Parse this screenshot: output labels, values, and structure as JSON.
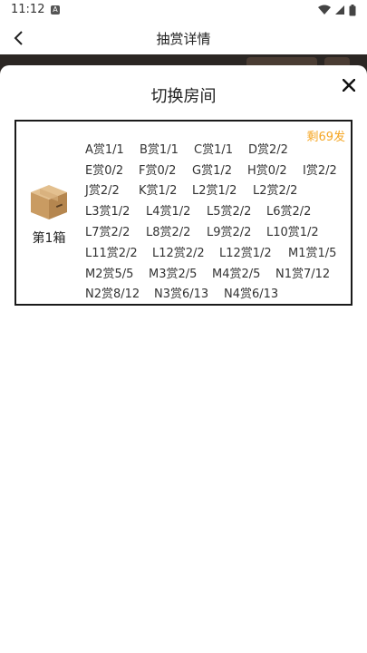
{
  "status": {
    "time": "11:12",
    "notif_letter": "A"
  },
  "nav": {
    "title": "抽赏详情"
  },
  "sheet": {
    "title": "切换房间"
  },
  "room": {
    "label": "第1箱",
    "remaining": "剩69发",
    "rows": [
      [
        "A赏1/1",
        "B赏1/1",
        "C赏1/1",
        "D赏2/2"
      ],
      [
        "E赏0/2",
        "F赏0/2",
        "G赏1/2",
        "H赏0/2",
        "I赏2/2"
      ],
      [
        "J赏2/2",
        "K赏1/2",
        "L2赏1/2",
        "L2赏2/2"
      ],
      [
        "L3赏1/2",
        "L4赏1/2",
        "L5赏2/2",
        "L6赏2/2"
      ],
      [
        "L7赏2/2",
        "L8赏2/2",
        "L9赏2/2",
        "L10赏1/2"
      ],
      [
        "L11赏2/2",
        "L12赏2/2",
        "L12赏1/2",
        "M1赏1/5"
      ],
      [
        "M2赏5/5",
        "M3赏2/5",
        "M4赏2/5",
        "N1赏7/12"
      ],
      [
        "N2赏8/12",
        "N3赏6/13",
        "N4赏6/13"
      ]
    ]
  },
  "colors": {
    "accent": "#f5a623",
    "border": "#1a1a1a",
    "backdrop": "#2b2623"
  }
}
